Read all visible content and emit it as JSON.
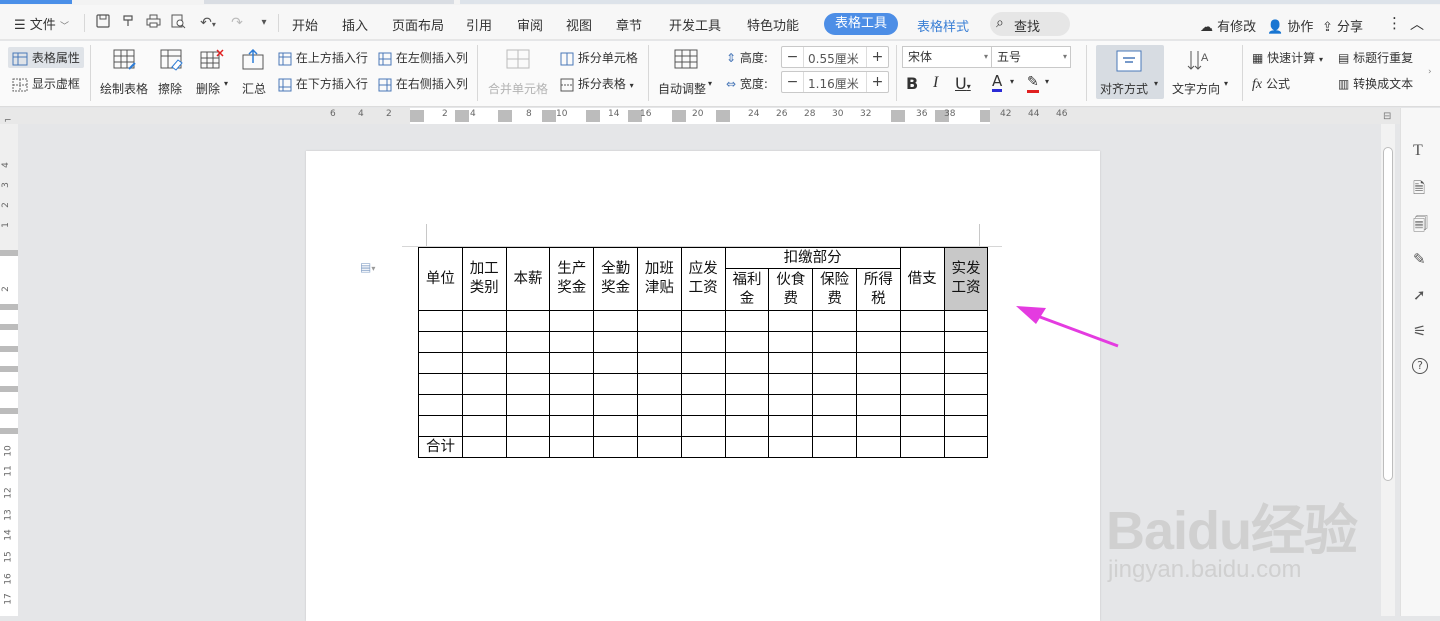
{
  "menu": {
    "file_label": "文件",
    "tabs": [
      "开始",
      "插入",
      "页面布局",
      "引用",
      "审阅",
      "视图",
      "章节",
      "开发工具",
      "特色功能"
    ],
    "active_tab": "表格工具",
    "style_tab": "表格样式",
    "search_label": "查找",
    "right": {
      "modified": "有修改",
      "collab": "协作",
      "share": "分享"
    }
  },
  "ribbon": {
    "table_props": "表格属性",
    "show_grid": "显示虚框",
    "draw_table": "绘制表格",
    "erase": "擦除",
    "delete": "删除",
    "summary": "汇总",
    "insert_above": "在上方插入行",
    "insert_below": "在下方插入行",
    "insert_left": "在左侧插入列",
    "insert_right": "在右侧插入列",
    "merge_cells": "合并单元格",
    "split_cells": "拆分单元格",
    "split_table": "拆分表格",
    "auto_fit": "自动调整",
    "height_label": "高度:",
    "height_value": "0.55厘米",
    "width_label": "宽度:",
    "width_value": "1.16厘米",
    "font_name": "宋体",
    "font_size": "五号",
    "align": "对齐方式",
    "text_dir": "文字方向",
    "quick_calc": "快速计算",
    "repeat_header": "标题行重复",
    "formula": "公式",
    "to_text": "转换成文本",
    "colors": {
      "font_underline": "#2b2bd6",
      "highlight_underline": "#e02020",
      "active_tab": "#4d8ee6"
    }
  },
  "ruler": {
    "h_numbers": [
      "6",
      "4",
      "2",
      "2",
      "4",
      "8",
      "10",
      "14",
      "16",
      "20",
      "24",
      "26",
      "28",
      "30",
      "32",
      "36",
      "38",
      "42",
      "44",
      "46"
    ],
    "v_numbers": [
      "4",
      "3",
      "2",
      "1",
      "2",
      "10",
      "11",
      "12",
      "13",
      "14",
      "15",
      "16",
      "17"
    ]
  },
  "table": {
    "header": {
      "unit": "单位",
      "process_type": "加工类别",
      "base_pay": "本薪",
      "production_bonus": "生产奖金",
      "attendance_bonus": "全勤奖金",
      "overtime_allowance": "加班津贴",
      "gross_pay": "应发工资",
      "deductions": "扣缴部分",
      "welfare": "福利金",
      "meals": "伙食费",
      "insurance": "保险费",
      "income_tax": "所得税",
      "advance": "借支",
      "net_pay": "实发工资"
    },
    "total_label": "合计",
    "empty_rows": 6
  },
  "watermark": {
    "brand": "Baidu经验",
    "url": "jingyan.baidu.com"
  }
}
